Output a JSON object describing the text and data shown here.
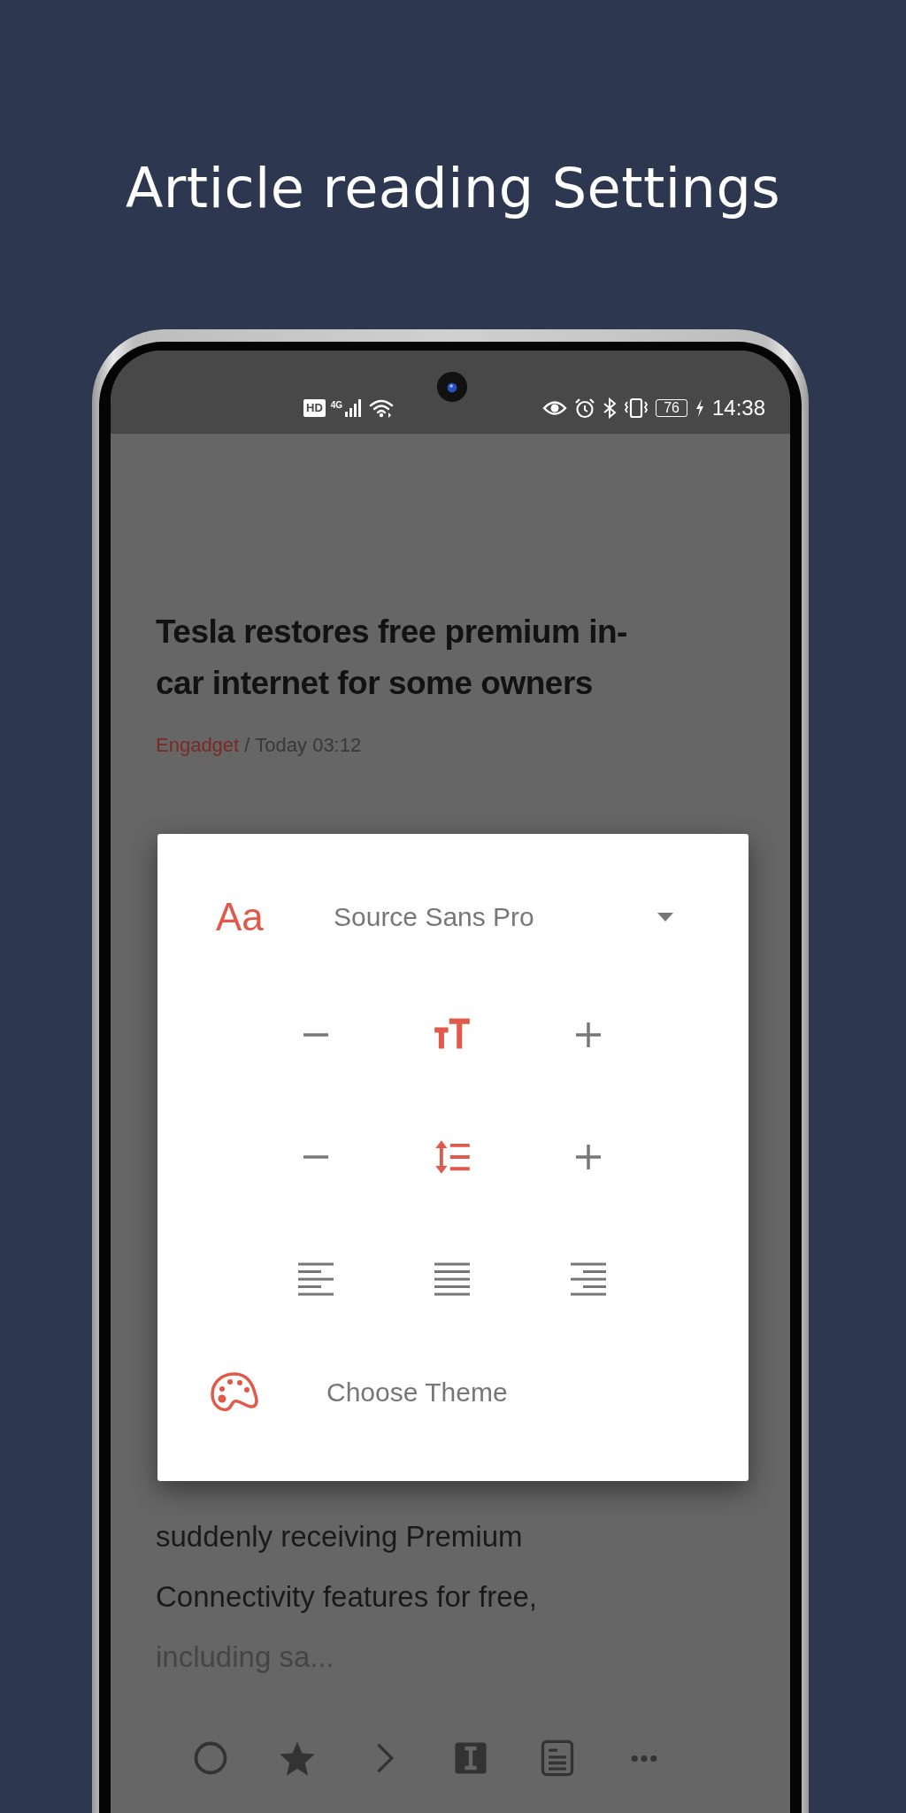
{
  "headline": "Article reading Settings",
  "status_bar": {
    "hd": "HD",
    "network": "4G",
    "battery": "76",
    "time": "14:38"
  },
  "article": {
    "title_lines": [
      "Tesla restores free premium in-",
      "car internet for some owners"
    ],
    "source": "Engadget",
    "separator": "/",
    "date": "Today 03:12",
    "excerpt_lines": [
      {
        "text": "suddenly receiving Premium",
        "faded": false
      },
      {
        "text": "Connectivity features for free,",
        "faded": false
      },
      {
        "text": "including sa...",
        "faded": true
      }
    ]
  },
  "reading_settings": {
    "font_icon": "Aa",
    "font": "Source Sans Pro",
    "steppers": [
      {
        "kind": "text_size"
      },
      {
        "kind": "line_spacing"
      }
    ],
    "alignments": [
      {
        "kind": "left"
      },
      {
        "kind": "justify"
      },
      {
        "kind": "right"
      }
    ],
    "theme": "Choose Theme"
  },
  "toolbar": [
    {
      "kind": "circle"
    },
    {
      "kind": "star"
    },
    {
      "kind": "next"
    },
    {
      "kind": "instapaper"
    },
    {
      "kind": "reader"
    },
    {
      "kind": "more"
    }
  ]
}
